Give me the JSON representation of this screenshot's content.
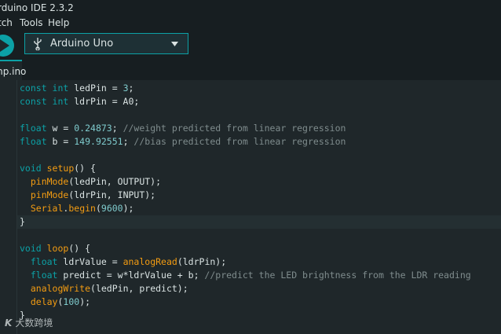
{
  "window": {
    "title": "rduino IDE 2.3.2"
  },
  "menu": {
    "items": [
      "tch",
      "Tools",
      "Help"
    ]
  },
  "toolbar": {
    "board_label": "Arduino Uno",
    "board_icon": "usb-icon",
    "caret_icon": "caret-down-icon",
    "verify_icon": "play-arrow-icon"
  },
  "tabs": [
    {
      "label": "mp.ino"
    }
  ],
  "colors": {
    "accent": "#0ca1a6",
    "keyword": "#0ca1a6",
    "function": "#f39c12",
    "number": "#7fcbcd",
    "comment": "#7f8c8d",
    "text": "#dae3e3"
  },
  "code_lines": [
    [
      [
        "kw",
        "const "
      ],
      [
        "kw",
        "int "
      ],
      [
        "plain",
        "ledPin = "
      ],
      [
        "num",
        "3"
      ],
      [
        "plain",
        ";"
      ]
    ],
    [
      [
        "kw",
        "const "
      ],
      [
        "kw",
        "int "
      ],
      [
        "plain",
        "ldrPin = A0;"
      ]
    ],
    [],
    [
      [
        "kw",
        "float "
      ],
      [
        "plain",
        "w = "
      ],
      [
        "num",
        "0.24873"
      ],
      [
        "plain",
        "; "
      ],
      [
        "cmt",
        "//weight predicted from linear regression"
      ]
    ],
    [
      [
        "kw",
        "float "
      ],
      [
        "plain",
        "b = "
      ],
      [
        "num",
        "149.92551"
      ],
      [
        "plain",
        "; "
      ],
      [
        "cmt",
        "//bias predicted from linear regression"
      ]
    ],
    [],
    [
      [
        "kw",
        "void "
      ],
      [
        "fn",
        "setup"
      ],
      [
        "plain",
        "() {"
      ]
    ],
    [
      [
        "plain",
        "  "
      ],
      [
        "fn",
        "pinMode"
      ],
      [
        "plain",
        "(ledPin, OUTPUT);"
      ]
    ],
    [
      [
        "plain",
        "  "
      ],
      [
        "fn",
        "pinMode"
      ],
      [
        "plain",
        "(ldrPin, INPUT);"
      ]
    ],
    [
      [
        "plain",
        "  "
      ],
      [
        "fn",
        "Serial"
      ],
      [
        "plain",
        "."
      ],
      [
        "fn",
        "begin"
      ],
      [
        "plain",
        "("
      ],
      [
        "num",
        "9600"
      ],
      [
        "plain",
        ");"
      ]
    ],
    [
      [
        "plain",
        "}"
      ]
    ],
    [],
    [
      [
        "kw",
        "void "
      ],
      [
        "fn",
        "loop"
      ],
      [
        "plain",
        "() {"
      ]
    ],
    [
      [
        "plain",
        "  "
      ],
      [
        "kw",
        "float "
      ],
      [
        "plain",
        "ldrValue = "
      ],
      [
        "fn",
        "analogRead"
      ],
      [
        "plain",
        "(ldrPin);"
      ]
    ],
    [
      [
        "plain",
        "  "
      ],
      [
        "kw",
        "float "
      ],
      [
        "plain",
        "predict = w*ldrValue + b; "
      ],
      [
        "cmt",
        "//predict the LED brightness from the LDR reading"
      ]
    ],
    [
      [
        "plain",
        "  "
      ],
      [
        "fn",
        "analogWrite"
      ],
      [
        "plain",
        "(ledPin, predict);"
      ]
    ],
    [
      [
        "plain",
        "  "
      ],
      [
        "fn",
        "delay"
      ],
      [
        "plain",
        "("
      ],
      [
        "num",
        "100"
      ],
      [
        "plain",
        ");"
      ]
    ],
    [
      [
        "plain",
        "}"
      ]
    ]
  ],
  "watermark": {
    "logo": "K",
    "text": "大数跨境"
  }
}
